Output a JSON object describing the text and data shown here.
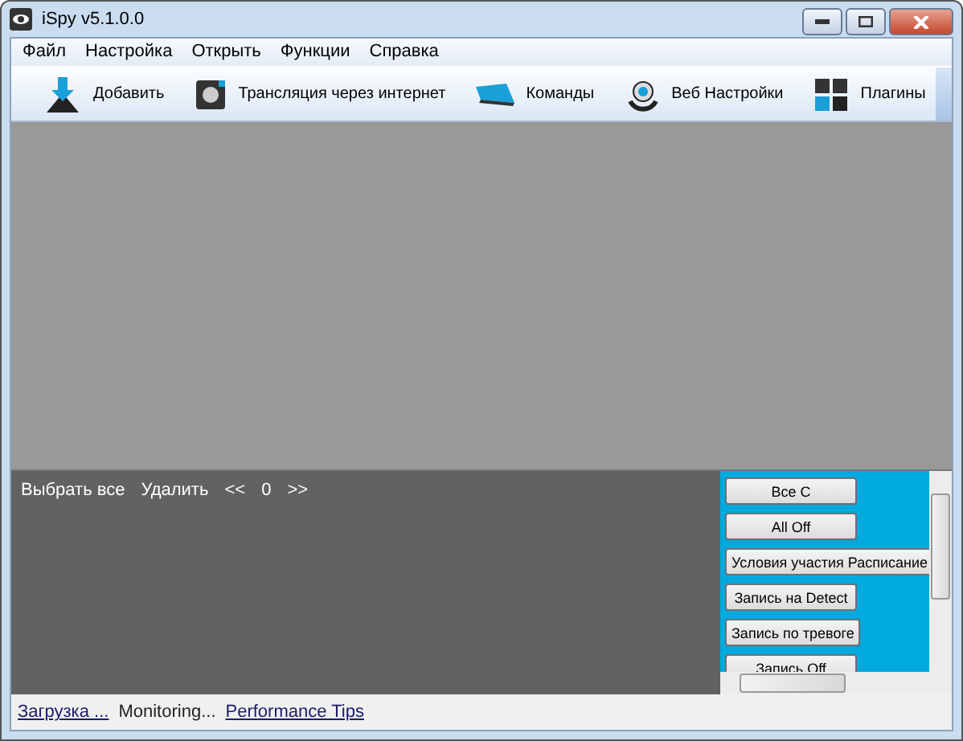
{
  "window": {
    "title": "iSpy v5.1.0.0"
  },
  "menu": [
    "Файл",
    "Настройка",
    "Открыть",
    "Функции",
    "Справка"
  ],
  "toolbar": [
    {
      "kind": "add",
      "label": "Добавить"
    },
    {
      "kind": "stream",
      "label": "Трансляция через интернет"
    },
    {
      "kind": "commands",
      "label": "Команды"
    },
    {
      "kind": "web",
      "label": "Веб Настройки"
    },
    {
      "kind": "plugins",
      "label": "Плагины"
    }
  ],
  "media_bar": {
    "select_all": "Выбрать все",
    "delete": "Удалить",
    "prev": "<<",
    "page": "0",
    "next": ">>"
  },
  "actions": [
    "Все С",
    "All Off",
    "Условия участия Расписание",
    "Запись на Detect",
    "Запись по тревоге",
    "Запись Off"
  ],
  "status_bar": [
    {
      "kind": "link",
      "text": "Загрузка ..."
    },
    {
      "kind": "text",
      "text": "Monitoring..."
    },
    {
      "kind": "link",
      "text": "Performance Tips"
    }
  ]
}
